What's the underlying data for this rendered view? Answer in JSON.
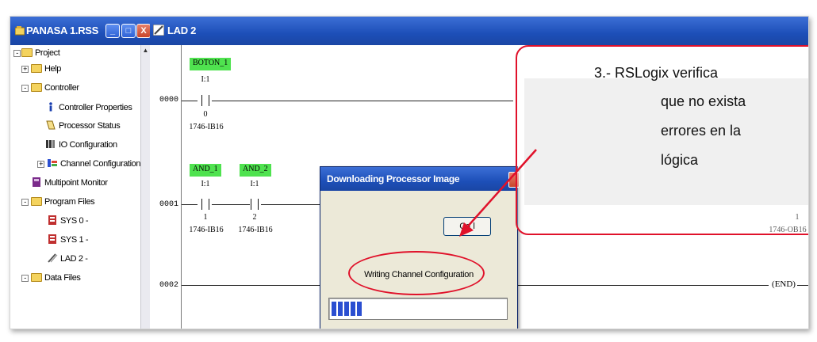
{
  "project_window": {
    "title": "PANASA 1.RSS",
    "buttons": {
      "minimize": "_",
      "maximize": "□",
      "close": "X"
    }
  },
  "tree": [
    {
      "label": "Project",
      "icon": "folder-icon",
      "expander": "-"
    },
    {
      "label": "Help",
      "icon": "folder-icon",
      "expander": "+"
    },
    {
      "label": "Controller",
      "icon": "folder-icon",
      "expander": "-"
    },
    {
      "label": "Controller Properties",
      "icon": "info-icon"
    },
    {
      "label": "Processor Status",
      "icon": "processor-status-icon"
    },
    {
      "label": "IO Configuration",
      "icon": "io-config-icon"
    },
    {
      "label": "Channel Configuration",
      "icon": "channel-config-icon",
      "expander": "+"
    },
    {
      "label": "Multipoint Monitor",
      "icon": "monitor-icon"
    },
    {
      "label": "Program Files",
      "icon": "folder-icon",
      "expander": "-"
    },
    {
      "label": "SYS 0 -",
      "icon": "program-file-icon"
    },
    {
      "label": "SYS 1 -",
      "icon": "program-file-icon"
    },
    {
      "label": "LAD 2 -",
      "icon": "ladder-file-icon"
    },
    {
      "label": "Data Files",
      "icon": "folder-icon",
      "expander": "-"
    }
  ],
  "ladder_window": {
    "title": "LAD 2"
  },
  "rungs": [
    {
      "number": "0000"
    },
    {
      "number": "0001"
    },
    {
      "number": "0002"
    }
  ],
  "instructions": {
    "boton1": {
      "tag": "BOTON_1",
      "address": "I:1",
      "bit": "0",
      "module": "1746-IB16"
    },
    "and1": {
      "tag": "AND_1",
      "address": "I:1",
      "bit": "1",
      "module": "1746-IB16"
    },
    "and2": {
      "tag": "AND_2",
      "address": "I:1",
      "bit": "2",
      "module": "1746-IB16"
    },
    "out": {
      "bit": "1",
      "module": "1746-OB16"
    },
    "end": "(END)"
  },
  "dialog": {
    "title": "Downloading Processor Image",
    "cancel_label": "Cancel",
    "cancel_visible": "Ca      l",
    "status": "Writing Channel Configuration",
    "progress": 0.2
  },
  "callout": {
    "title": "3.- RSLogix verifica",
    "lines": [
      "que no exista",
      "errores en la",
      "lógica"
    ]
  },
  "colors": {
    "tag_green": "#4fe24f",
    "annotation_red": "#e0112a",
    "titlebar_blue": "#1d4fb8"
  }
}
